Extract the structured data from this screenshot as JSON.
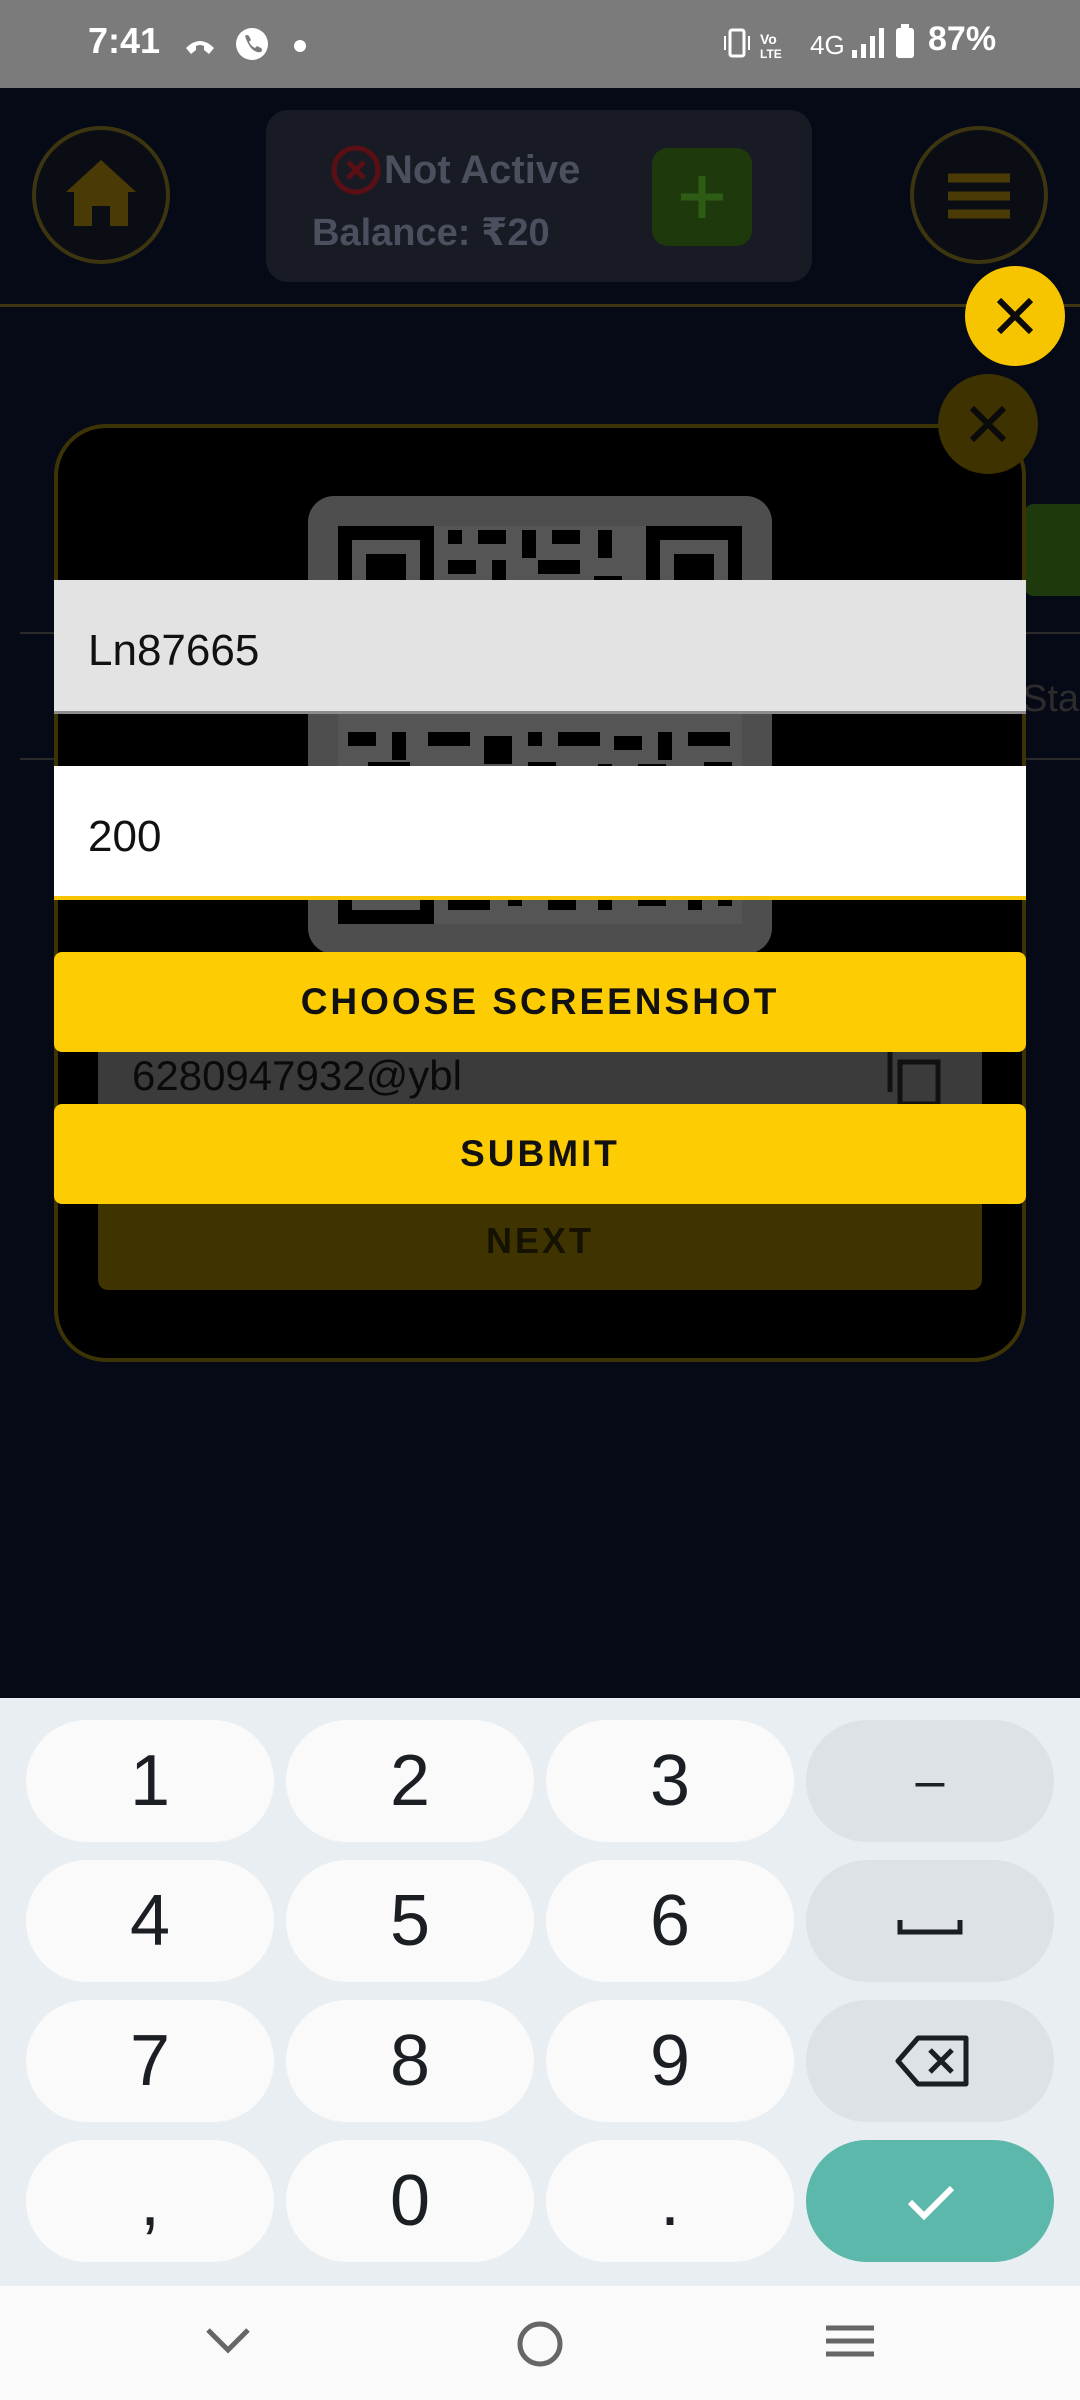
{
  "status_bar": {
    "time": "7:41",
    "battery_percent": "87%",
    "network": "4G"
  },
  "header": {
    "status_text": "Not Active",
    "balance_text": "Balance: ₹20"
  },
  "dialog": {
    "upi_id": "6280947932@ybl",
    "next_label": "NEXT",
    "side_text": "Sta"
  },
  "form": {
    "user_id_value": "Ln87665",
    "amount_value": "200",
    "choose_label": "CHOOSE SCREENSHOT",
    "submit_label": "SUBMIT"
  },
  "keyboard": {
    "keys": [
      "1",
      "2",
      "3",
      "–",
      "4",
      "5",
      "6",
      "␣",
      "7",
      "8",
      "9",
      "⌫",
      ",",
      "0",
      ".",
      "✓"
    ]
  },
  "colors": {
    "accent": "#fecc02",
    "done_key": "#5cb8aa"
  }
}
